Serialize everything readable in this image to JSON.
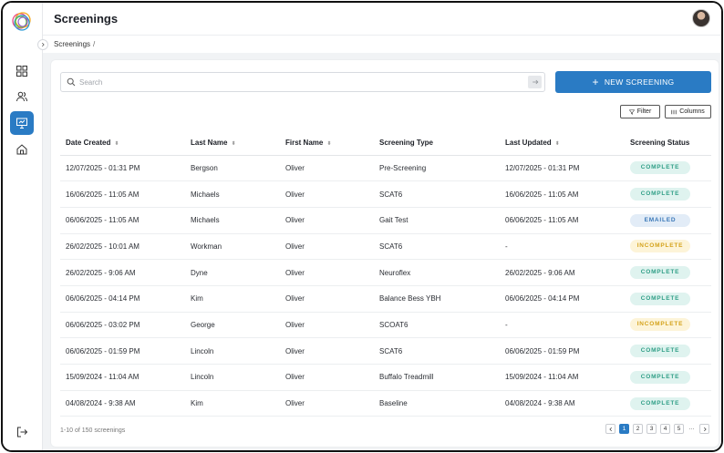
{
  "header": {
    "title": "Screenings"
  },
  "breadcrumb": {
    "item": "Screenings",
    "separator": "/"
  },
  "search": {
    "placeholder": "Search",
    "value": ""
  },
  "actions": {
    "new_label": "NEW SCREENING",
    "filter_label": "Filter",
    "columns_label": "Columns"
  },
  "icons": {
    "logo": "rings-logo",
    "dashboard": "grid-icon",
    "users": "users-icon",
    "screenings": "monitor-icon",
    "home": "home-icon",
    "logout": "logout-icon"
  },
  "colors": {
    "accent": "#2a7bc4",
    "complete": "#2f9e86",
    "emailed": "#3a78b8",
    "incomplete": "#d4a21a"
  },
  "table": {
    "columns": [
      "Date Created",
      "Last Name",
      "First Name",
      "Screening Type",
      "Last Updated",
      "Screening Status"
    ],
    "rows": [
      {
        "created": "12/07/2025 - 01:31 PM",
        "last": "Bergson",
        "first": "Oliver",
        "type": "Pre-Screening",
        "updated": "12/07/2025 - 01:31 PM",
        "status": "COMPLETE",
        "kind": "complete"
      },
      {
        "created": "16/06/2025 - 11:05 AM",
        "last": "Michaels",
        "first": "Oliver",
        "type": "SCAT6",
        "updated": "16/06/2025 - 11:05 AM",
        "status": "COMPLETE",
        "kind": "complete"
      },
      {
        "created": "06/06/2025 - 11:05 AM",
        "last": "Michaels",
        "first": "Oliver",
        "type": "Gait Test",
        "updated": "06/06/2025 - 11:05 AM",
        "status": "EMAILED",
        "kind": "emailed"
      },
      {
        "created": "26/02/2025 - 10:01 AM",
        "last": "Workman",
        "first": "Oliver",
        "type": "SCAT6",
        "updated": "-",
        "status": "INCOMPLETE",
        "kind": "incomplete"
      },
      {
        "created": "26/02/2025 -  9:06 AM",
        "last": "Dyne",
        "first": "Oliver",
        "type": "Neuroflex",
        "updated": "26/02/2025 -  9:06 AM",
        "status": "COMPLETE",
        "kind": "complete"
      },
      {
        "created": "06/06/2025 - 04:14 PM",
        "last": "Kim",
        "first": "Oliver",
        "type": "Balance Bess YBH",
        "updated": "06/06/2025 - 04:14 PM",
        "status": "COMPLETE",
        "kind": "complete"
      },
      {
        "created": "06/06/2025 - 03:02 PM",
        "last": "George",
        "first": "Oliver",
        "type": "SCOAT6",
        "updated": "-",
        "status": "INCOMPLETE",
        "kind": "incomplete"
      },
      {
        "created": "06/06/2025 - 01:59 PM",
        "last": "Lincoln",
        "first": "Oliver",
        "type": "SCAT6",
        "updated": "06/06/2025 - 01:59 PM",
        "status": "COMPLETE",
        "kind": "complete"
      },
      {
        "created": "15/09/2024 - 11:04 AM",
        "last": "Lincoln",
        "first": "Oliver",
        "type": "Buffalo Treadmill",
        "updated": "15/09/2024 - 11:04 AM",
        "status": "COMPLETE",
        "kind": "complete"
      },
      {
        "created": "04/08/2024 - 9:38 AM",
        "last": "Kim",
        "first": "Oliver",
        "type": "Baseline",
        "updated": "04/08/2024 - 9:38 AM",
        "status": "COMPLETE",
        "kind": "complete"
      }
    ]
  },
  "footer": {
    "count_text": "1-10 of 150 screenings"
  },
  "pagination": {
    "pages": [
      "1",
      "2",
      "3",
      "4",
      "5"
    ],
    "current": "1",
    "ellipsis": "···"
  }
}
